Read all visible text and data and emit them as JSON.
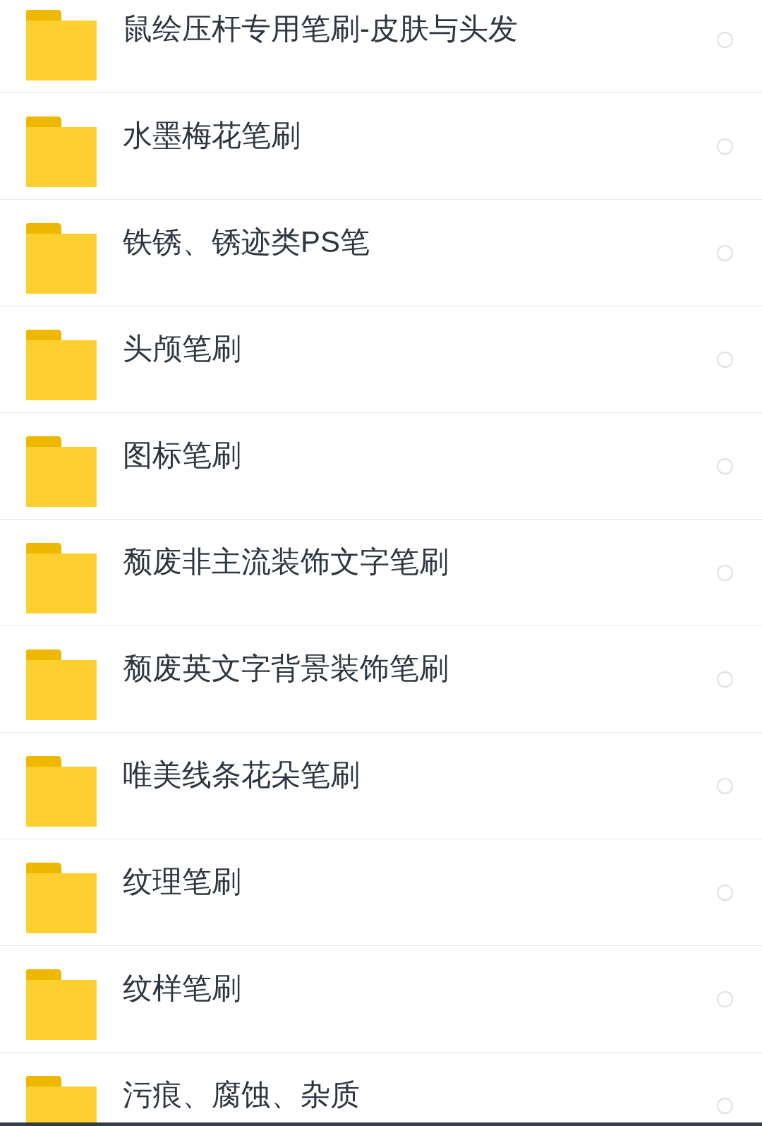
{
  "files": [
    {
      "name": "鼠绘压杆专用笔刷-皮肤与头发",
      "kind": "folder",
      "selected": false
    },
    {
      "name": "水墨梅花笔刷",
      "kind": "folder",
      "selected": false
    },
    {
      "name": "铁锈、锈迹类PS笔",
      "kind": "folder",
      "selected": false
    },
    {
      "name": "头颅笔刷",
      "kind": "folder",
      "selected": false
    },
    {
      "name": "图标笔刷",
      "kind": "folder",
      "selected": false
    },
    {
      "name": "颓废非主流装饰文字笔刷",
      "kind": "folder",
      "selected": false
    },
    {
      "name": "颓废英文字背景装饰笔刷",
      "kind": "folder",
      "selected": false
    },
    {
      "name": "唯美线条花朵笔刷",
      "kind": "folder",
      "selected": false
    },
    {
      "name": "纹理笔刷",
      "kind": "folder",
      "selected": false
    },
    {
      "name": "纹样笔刷",
      "kind": "folder",
      "selected": false
    },
    {
      "name": "污痕、腐蚀、杂质",
      "kind": "folder",
      "selected": false
    }
  ]
}
